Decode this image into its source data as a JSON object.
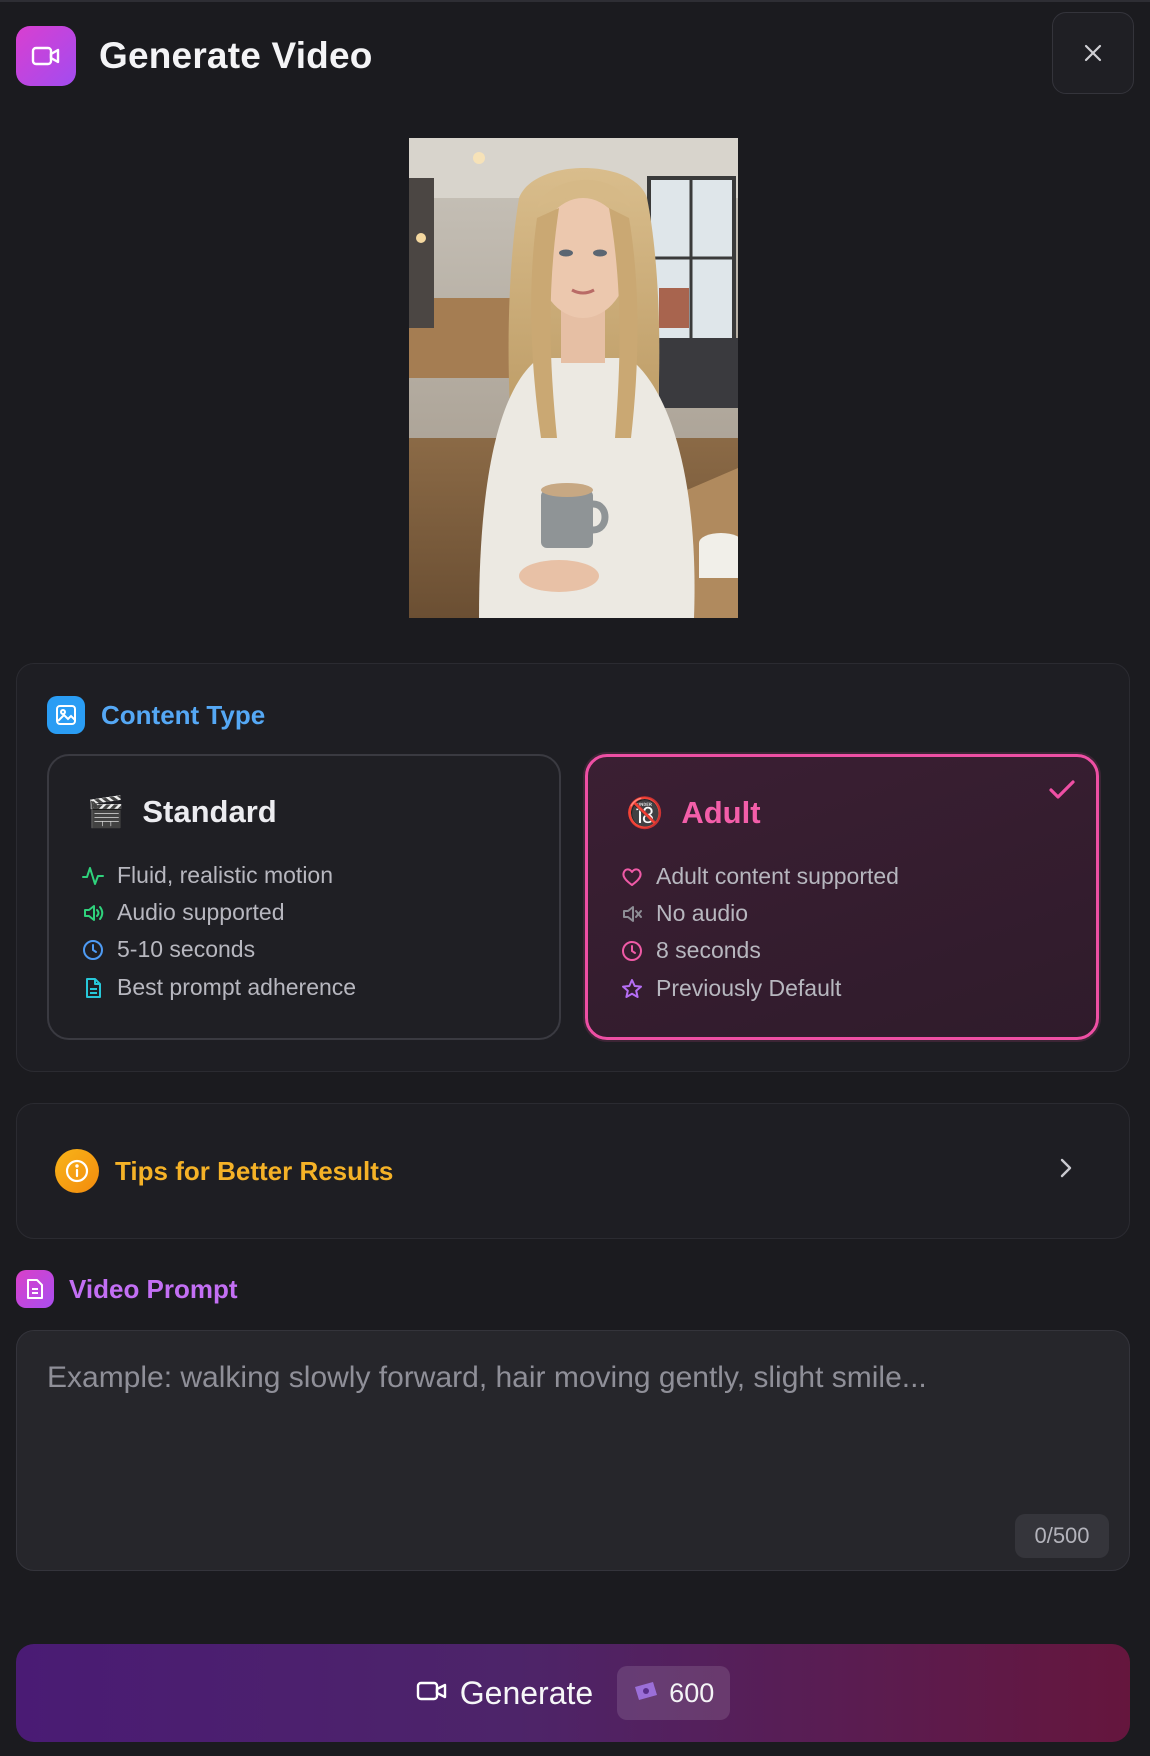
{
  "header": {
    "title": "Generate Video",
    "icon": "video-camera-icon",
    "close_icon": "close-icon"
  },
  "content_type": {
    "label": "Content Type",
    "icon": "image-icon",
    "options": [
      {
        "title": "Standard",
        "emoji": "🎬",
        "selected": false,
        "features": [
          {
            "icon": "activity-icon",
            "text": "Fluid, realistic motion",
            "color": "#2fd27c"
          },
          {
            "icon": "speaker-icon",
            "text": "Audio supported",
            "color": "#2fd27c"
          },
          {
            "icon": "clock-icon",
            "text": "5-10 seconds",
            "color": "#4e9bf5"
          },
          {
            "icon": "document-icon",
            "text": "Best prompt adherence",
            "color": "#27c7d8"
          }
        ]
      },
      {
        "title": "Adult",
        "emoji": "🔞",
        "selected": true,
        "features": [
          {
            "icon": "heart-icon",
            "text": "Adult content supported",
            "color": "#ef5aa6"
          },
          {
            "icon": "muted-speaker-icon",
            "text": "No audio",
            "color": "#8d8d95"
          },
          {
            "icon": "clock-icon",
            "text": "8 seconds",
            "color": "#ef5aa6"
          },
          {
            "icon": "star-icon",
            "text": "Previously Default",
            "color": "#b56ef4"
          }
        ]
      }
    ]
  },
  "tips": {
    "label": "Tips for Better Results",
    "icon": "info-icon"
  },
  "prompt": {
    "label": "Video Prompt",
    "icon": "document-icon",
    "placeholder": "Example: walking slowly forward, hair moving gently, slight smile...",
    "counter": "0/500"
  },
  "generate": {
    "label": "Generate",
    "credits": "600",
    "icon": "video-camera-icon",
    "credits_icon": "ticket-icon"
  },
  "colors": {
    "accent_pink": "#ee4fa4",
    "accent_blue": "#55a8f5",
    "accent_amber": "#f5b227",
    "accent_purple": "#c36ff4"
  }
}
